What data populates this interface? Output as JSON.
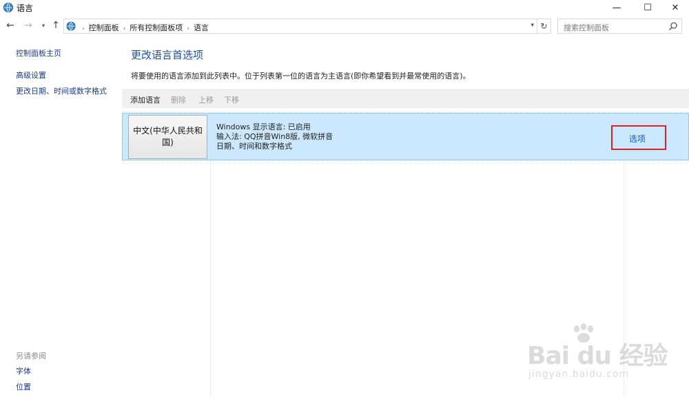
{
  "window": {
    "title": "语言",
    "minimize": "—",
    "maximize": "☐",
    "close": "✕"
  },
  "nav": {
    "back": "←",
    "forward": "→",
    "history": "▾",
    "up": "↑"
  },
  "address": {
    "crumbs": [
      "控制面板",
      "所有控制面板项",
      "语言"
    ],
    "refresh": "↻"
  },
  "search": {
    "placeholder": "搜索控制面板"
  },
  "sidebar": {
    "home": "控制面板主页",
    "links": [
      "高级设置",
      "更改日期、时间或数字格式"
    ],
    "see_also_heading": "另请参阅",
    "see_also": [
      "字体",
      "位置"
    ]
  },
  "main": {
    "heading": "更改语言首选项",
    "description": "将要使用的语言添加到此列表中。位于列表第一位的语言为主语言(即你希望看到并最常使用的语言)。",
    "toolbar": {
      "add": "添加语言",
      "remove": "删除",
      "move_up": "上移",
      "move_down": "下移"
    },
    "languages": [
      {
        "name": "中文(中华人民共和国)",
        "details": [
          "Windows 显示语言: 已启用",
          "输入法: QQ拼音Win8版, 微软拼音",
          "日期、时间和数字格式"
        ],
        "options_label": "选项"
      }
    ]
  },
  "watermark": {
    "main": "Bai du 经验",
    "sub": "jingyan.baidu.com"
  },
  "colors": {
    "heading": "#1c4f9c",
    "row_selected": "#cce8ff",
    "highlight_box": "#e02020",
    "link": "#1a56c9"
  }
}
